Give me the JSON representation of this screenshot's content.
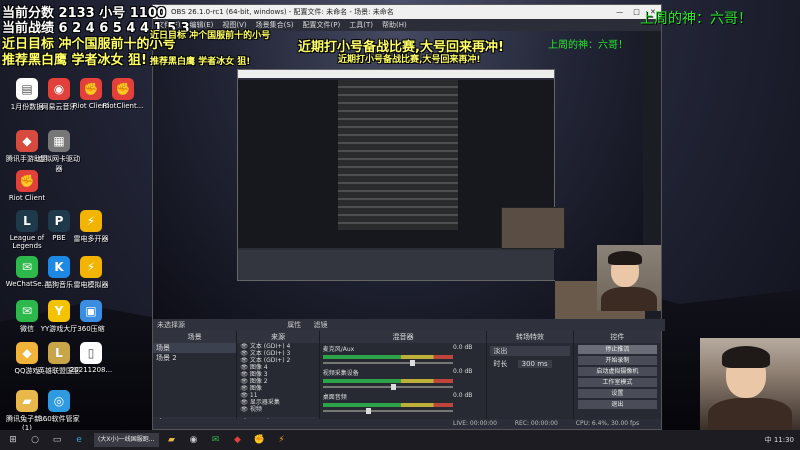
{
  "overlay": {
    "score": "当前分数 2133 小号 1100",
    "record": "当前战绩 6 2 4 6 5 4 4 1 5 3",
    "goal": "近日目标 冲个国服前十的小号",
    "recommend": "推荐黑白鹰 学者冰女 狙!",
    "big_caption": "近期打小号备战比赛,大号回来再冲!",
    "weekly_god": "上周的神：六哥！"
  },
  "desktop_icons": [
    {
      "label": "1月份数据",
      "icon": "doc-icon",
      "color": "#ffffff",
      "glyph": "▤"
    },
    {
      "label": "网易云音乐",
      "icon": "netease-icon",
      "color": "#e2403a",
      "glyph": "◉"
    },
    {
      "label": "Riot Client",
      "icon": "riot-icon",
      "color": "#e2403a",
      "glyph": "✊"
    },
    {
      "label": "RiotClient...",
      "icon": "riot-icon",
      "color": "#e2403a",
      "glyph": "✊"
    },
    {
      "label": "腾讯手游助手",
      "icon": "tencent-icon",
      "color": "#d64b3e",
      "glyph": "◆"
    },
    {
      "label": "虚拟网卡驱动器",
      "icon": "driver-icon",
      "color": "#777777",
      "glyph": "▦"
    },
    {
      "label": "Riot Client",
      "icon": "riot-icon",
      "color": "#e2403a",
      "glyph": "✊"
    },
    {
      "label": "League of Legends",
      "icon": "lol-icon",
      "color": "#1e3a4a",
      "glyph": "L"
    },
    {
      "label": "PBE",
      "icon": "pbe-icon",
      "color": "#1e3a4a",
      "glyph": "P"
    },
    {
      "label": "雷电多开器",
      "icon": "ld-icon",
      "color": "#f2b400",
      "glyph": "⚡"
    },
    {
      "label": "WeChatSe...",
      "icon": "wechat-icon",
      "color": "#2cb84a",
      "glyph": "✉"
    },
    {
      "label": "酷狗音乐",
      "icon": "kugou-icon",
      "color": "#1e88e5",
      "glyph": "K"
    },
    {
      "label": "雷电模拟器",
      "icon": "ld-icon",
      "color": "#f2b400",
      "glyph": "⚡"
    },
    {
      "label": "微信",
      "icon": "wechat-icon",
      "color": "#2cb84a",
      "glyph": "✉"
    },
    {
      "label": "YY游戏大厅",
      "icon": "yy-icon",
      "color": "#f3c200",
      "glyph": "Y"
    },
    {
      "label": "360压缩",
      "icon": "zip-icon",
      "color": "#3a8de0",
      "glyph": "▣"
    },
    {
      "label": "QQ游戏",
      "icon": "qqgame-icon",
      "color": "#f0b43a",
      "glyph": "◆"
    },
    {
      "label": "英雄联盟国服",
      "icon": "lol-cn-icon",
      "color": "#c9a54a",
      "glyph": "L"
    },
    {
      "label": "20211208...",
      "icon": "file-icon",
      "color": "#ffffff",
      "glyph": "▯"
    },
    {
      "label": "腾讯兔子新... (1)",
      "icon": "folder-icon",
      "color": "#e8b84a",
      "glyph": "▰"
    },
    {
      "label": "360软件管家",
      "icon": "360-icon",
      "color": "#2e9ae0",
      "glyph": "◎"
    }
  ],
  "obs": {
    "window_title": "OBS 26.1.0-rc1 (64-bit, windows) - 配置文件: 未命名 - 场景: 未命名",
    "menus": [
      "文件(F)",
      "编辑(E)",
      "视图(V)",
      "场景集合(S)",
      "配置文件(P)",
      "工具(T)",
      "帮助(H)"
    ],
    "scene_label": "未选择源",
    "toolbar_items": [
      "属性",
      "滤镜"
    ],
    "docks": {
      "scenes": {
        "title": "场景",
        "items": [
          "场景",
          "场景 2"
        ]
      },
      "sources": {
        "title": "来源",
        "items": [
          "文本 (GDI+) 4",
          "文本 (GDI+) 3",
          "文本 (GDI+) 2",
          "图像 4",
          "图像 3",
          "图像 2",
          "图像",
          "11",
          "显示器采集",
          "视频"
        ]
      },
      "mixer": {
        "title": "混音器",
        "channels": [
          {
            "name": "麦克风/Aux",
            "db": "0.0 dB",
            "level": 0.7
          },
          {
            "name": "视频采集设备",
            "db": "0.0 dB",
            "level": 0.55
          },
          {
            "name": "桌面音频",
            "db": "0.0 dB",
            "level": 0.35
          }
        ]
      },
      "transitions": {
        "title": "转场特效",
        "mode": "淡出",
        "duration_label": "时长",
        "duration": "300 ms"
      },
      "controls": {
        "title": "控件",
        "buttons": [
          "停止推流",
          "开始录制",
          "启动虚拟摄像机",
          "工作室模式",
          "设置",
          "退出"
        ]
      }
    },
    "status": {
      "live": "LIVE: 00:00:00",
      "rec": "REC: 00:00:00",
      "cpu": "CPU: 6.4%, 30.00 fps"
    }
  },
  "taskbar": {
    "task_label": "(大X小)一线国服跑...",
    "tray": "中 11:30"
  }
}
